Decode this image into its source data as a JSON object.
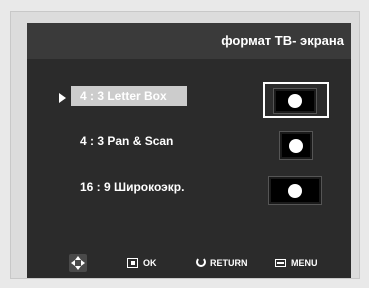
{
  "header": {
    "title": "формат ТВ- экрана"
  },
  "options": [
    {
      "label": "4 : 3  Letter Box",
      "icon": "letterbox-screen-icon",
      "selected": true
    },
    {
      "label": "4 : 3  Pan & Scan",
      "icon": "pan-scan-screen-icon",
      "selected": false
    },
    {
      "label": "16 : 9  Широкоэкр.",
      "icon": "widescreen-screen-icon",
      "selected": false
    }
  ],
  "footer": {
    "navigate_icon": "dpad-icon",
    "ok_label": "OK",
    "return_label": "RETURN",
    "menu_label": "MENU"
  },
  "colors": {
    "screen_bg": "#2b2b2b",
    "title_bar_bg": "#3a3a3a",
    "highlight_bg": "#cccccc",
    "text": "#ffffff",
    "frame_bg": "#dcdcdc"
  }
}
